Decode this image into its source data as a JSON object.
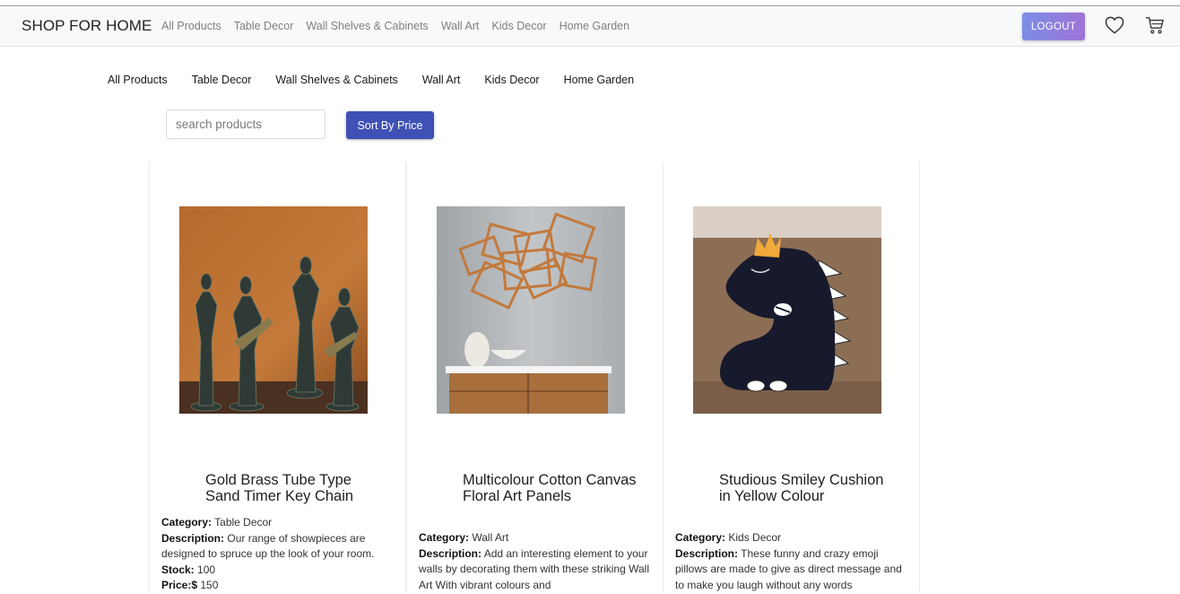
{
  "navbar": {
    "brand": "SHOP FOR HOME",
    "links": [
      "All Products",
      "Table Decor",
      "Wall Shelves & Cabinets",
      "Wall Art",
      "Kids Decor",
      "Home Garden"
    ],
    "logout_label": "LOGOUT",
    "icons": [
      "heart-icon",
      "cart-icon"
    ]
  },
  "categories": [
    "All Products",
    "Table Decor",
    "Wall Shelves & Cabinets",
    "Wall Art",
    "Kids Decor",
    "Home Garden"
  ],
  "search": {
    "placeholder": "search products",
    "value": ""
  },
  "sort_label": "Sort By Price",
  "labels": {
    "category": "Category:",
    "description": "Description:",
    "stock": "Stock:",
    "price": "Price:$"
  },
  "products": [
    {
      "title": "Gold Brass Tube Type Sand Timer Key Chain",
      "category": "Table Decor",
      "description": "Our range of showpieces are designed to spruce up the look of your room.",
      "stock": "100",
      "price": "150"
    },
    {
      "title": "Multicolour Cotton Canvas Floral Art Panels",
      "category": "Wall Art",
      "description": "Add an interesting element to your walls by decorating them with these striking Wall Art With vibrant colours and",
      "stock": "",
      "price": ""
    },
    {
      "title": "Studious Smiley Cushion in Yellow Colour",
      "category": "Kids Decor",
      "description": "These funny and crazy emoji pillows are made to give as direct message and to make you laugh without any words",
      "stock": "",
      "price": ""
    }
  ],
  "colors": {
    "primary": "#3f51b5",
    "logout_from": "#7b8de6",
    "logout_to": "#9f73d6"
  }
}
